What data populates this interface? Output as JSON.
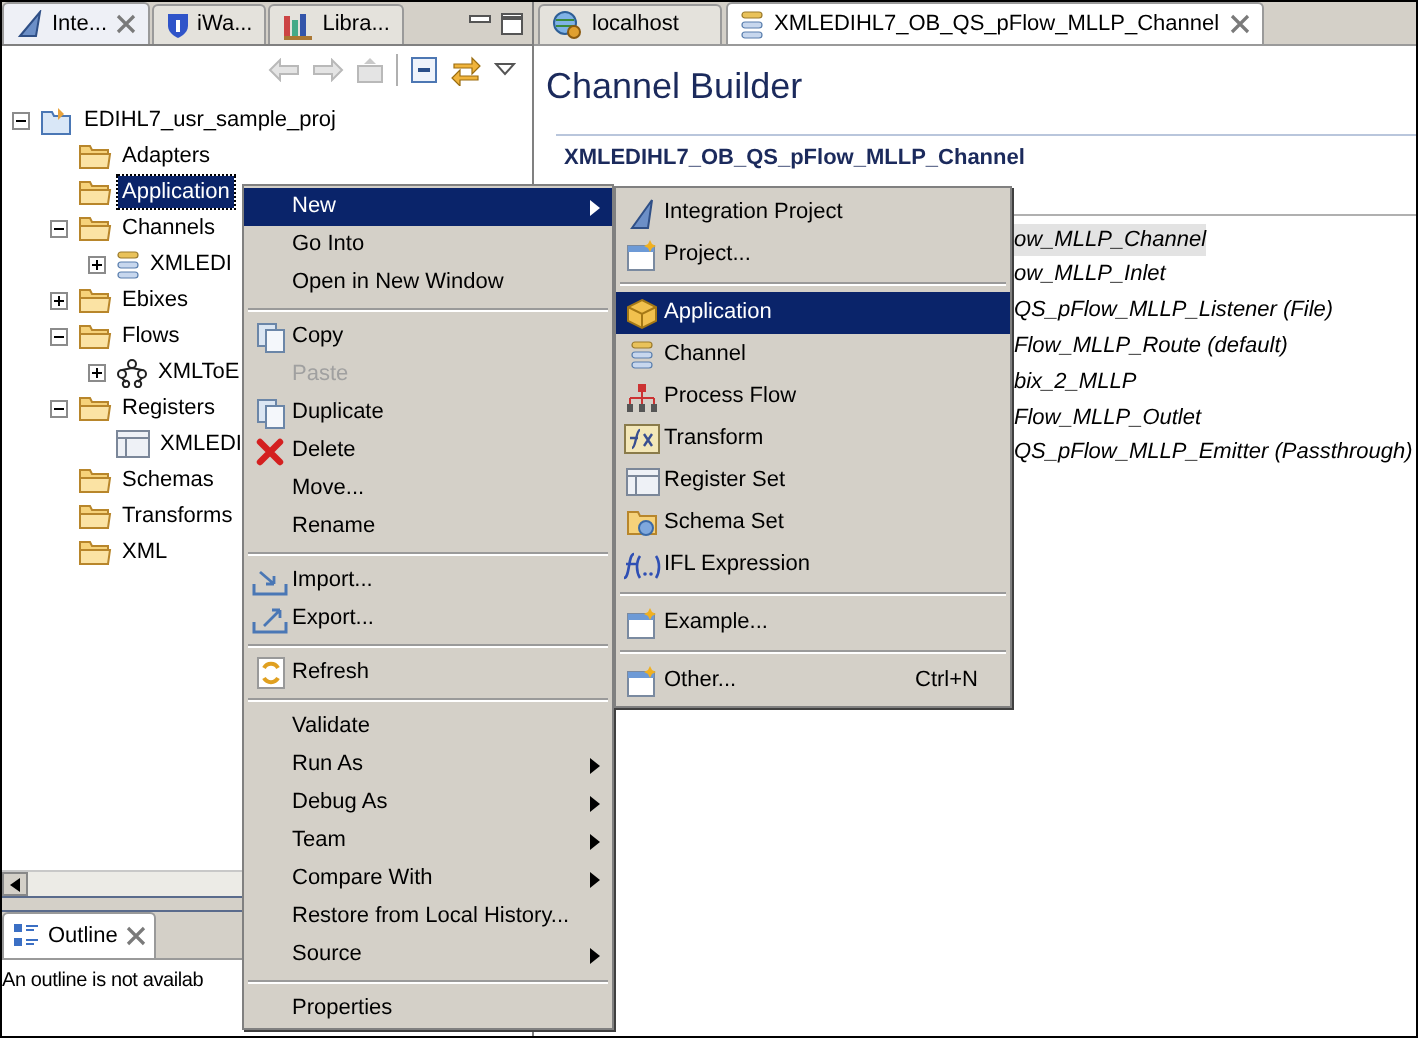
{
  "left_panel": {
    "tabs": [
      {
        "label": "Inte...",
        "selected": true
      },
      {
        "label": "iWa...",
        "selected": false
      },
      {
        "label": "Libra...",
        "selected": false
      }
    ],
    "tree": [
      {
        "label": "EDIHL7_usr_sample_proj",
        "kind": "project",
        "expanded": true,
        "selected": false,
        "children": [
          {
            "label": "Adapters",
            "kind": "folder",
            "selected": false
          },
          {
            "label": "Application",
            "kind": "folder",
            "selected": true
          },
          {
            "label": "Channels",
            "kind": "folder",
            "expanded": true,
            "selected": false,
            "children": [
              {
                "label": "XMLEDI",
                "kind": "channel",
                "expanded": false,
                "selected": false
              }
            ]
          },
          {
            "label": "Ebixes",
            "kind": "folder",
            "expanded": false,
            "selected": false
          },
          {
            "label": "Flows",
            "kind": "folder",
            "expanded": true,
            "selected": false,
            "children": [
              {
                "label": "XMLToE",
                "kind": "flow",
                "expanded": false,
                "selected": false
              }
            ]
          },
          {
            "label": "Registers",
            "kind": "folder",
            "expanded": true,
            "selected": false,
            "children": [
              {
                "label": "XMLEDI",
                "kind": "register",
                "selected": false
              }
            ]
          },
          {
            "label": "Schemas",
            "kind": "folder",
            "selected": false
          },
          {
            "label": "Transforms",
            "kind": "folder",
            "selected": false
          },
          {
            "label": "XML",
            "kind": "folder",
            "selected": false
          }
        ]
      }
    ],
    "outline": {
      "tab": "Outline",
      "message": "An outline is not availab"
    }
  },
  "editor": {
    "tabs": [
      {
        "label": "localhost",
        "selected": false
      },
      {
        "label": "XMLEDIHL7_OB_QS_pFlow_MLLP_Channel",
        "selected": true
      }
    ],
    "title": "Channel Builder",
    "section": "XMLEDIHL7_OB_QS_pFlow_MLLP_Channel",
    "items": [
      {
        "label": "ow_MLLP_Channel",
        "selected": true
      },
      {
        "label": "ow_MLLP_Inlet",
        "selected": false
      },
      {
        "label": "QS_pFlow_MLLP_Listener (File)",
        "selected": false
      },
      {
        "label": "Flow_MLLP_Route (default)",
        "selected": false
      },
      {
        "label": "bix_2_MLLP",
        "selected": false
      },
      {
        "label": "Flow_MLLP_Outlet",
        "selected": false
      },
      {
        "label": "QS_pFlow_MLLP_Emitter (Passthrough)",
        "selected": false
      }
    ]
  },
  "context_menu": {
    "items": [
      {
        "kind": "item",
        "label": "New",
        "selected": true,
        "disabled": false,
        "submenu": true
      },
      {
        "kind": "item",
        "label": "Go Into",
        "selected": false,
        "disabled": false,
        "submenu": false
      },
      {
        "kind": "item",
        "label": "Open in New Window",
        "selected": false,
        "disabled": false,
        "submenu": false
      },
      {
        "kind": "separator"
      },
      {
        "kind": "item",
        "label": "Copy",
        "selected": false,
        "disabled": false,
        "submenu": false
      },
      {
        "kind": "item",
        "label": "Paste",
        "selected": false,
        "disabled": true,
        "submenu": false
      },
      {
        "kind": "item",
        "label": "Duplicate",
        "selected": false,
        "disabled": false,
        "submenu": false
      },
      {
        "kind": "item",
        "label": "Delete",
        "selected": false,
        "disabled": false,
        "submenu": false
      },
      {
        "kind": "item",
        "label": "Move...",
        "selected": false,
        "disabled": false,
        "submenu": false
      },
      {
        "kind": "item",
        "label": "Rename",
        "selected": false,
        "disabled": false,
        "submenu": false
      },
      {
        "kind": "separator"
      },
      {
        "kind": "item",
        "label": "Import...",
        "selected": false,
        "disabled": false,
        "submenu": false
      },
      {
        "kind": "item",
        "label": "Export...",
        "selected": false,
        "disabled": false,
        "submenu": false
      },
      {
        "kind": "separator"
      },
      {
        "kind": "item",
        "label": "Refresh",
        "selected": false,
        "disabled": false,
        "submenu": false
      },
      {
        "kind": "separator"
      },
      {
        "kind": "item",
        "label": "Validate",
        "selected": false,
        "disabled": false,
        "submenu": false
      },
      {
        "kind": "item",
        "label": "Run As",
        "selected": false,
        "disabled": false,
        "submenu": true
      },
      {
        "kind": "item",
        "label": "Debug As",
        "selected": false,
        "disabled": false,
        "submenu": true
      },
      {
        "kind": "item",
        "label": "Team",
        "selected": false,
        "disabled": false,
        "submenu": true
      },
      {
        "kind": "item",
        "label": "Compare With",
        "selected": false,
        "disabled": false,
        "submenu": true
      },
      {
        "kind": "item",
        "label": "Restore from Local History...",
        "selected": false,
        "disabled": false,
        "submenu": false
      },
      {
        "kind": "item",
        "label": "Source",
        "selected": false,
        "disabled": false,
        "submenu": true
      },
      {
        "kind": "separator"
      },
      {
        "kind": "item",
        "label": "Properties",
        "selected": false,
        "disabled": false,
        "submenu": false
      }
    ]
  },
  "submenu": {
    "items": [
      {
        "kind": "item",
        "label": "Integration Project",
        "selected": false
      },
      {
        "kind": "item",
        "label": "Project...",
        "selected": false
      },
      {
        "kind": "separator"
      },
      {
        "kind": "item",
        "label": "Application",
        "selected": true
      },
      {
        "kind": "item",
        "label": "Channel",
        "selected": false
      },
      {
        "kind": "item",
        "label": "Process Flow",
        "selected": false
      },
      {
        "kind": "item",
        "label": "Transform",
        "selected": false
      },
      {
        "kind": "item",
        "label": "Register Set",
        "selected": false
      },
      {
        "kind": "item",
        "label": "Schema Set",
        "selected": false
      },
      {
        "kind": "item",
        "label": "IFL Expression",
        "selected": false
      },
      {
        "kind": "separator"
      },
      {
        "kind": "item",
        "label": "Example...",
        "selected": false
      },
      {
        "kind": "separator"
      },
      {
        "kind": "item",
        "label": "Other...",
        "selected": false,
        "shortcut": "Ctrl+N"
      }
    ]
  }
}
